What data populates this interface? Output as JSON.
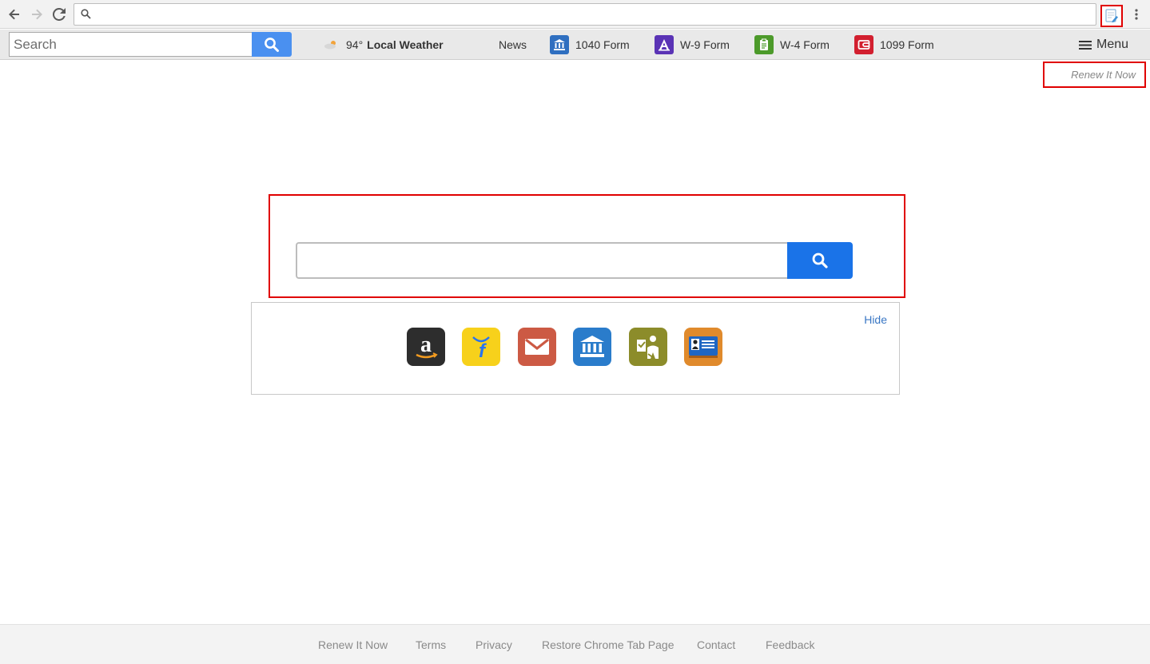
{
  "browser": {
    "address_value": "",
    "icons": [
      "back-arrow-icon",
      "forward-arrow-icon",
      "reload-icon",
      "search-icon",
      "extension-icon",
      "more-vert-icon"
    ]
  },
  "toolbar": {
    "search_placeholder": "Search",
    "weather": {
      "temp": "94°",
      "label": "Local Weather"
    },
    "news_label": "News",
    "links": [
      {
        "label": "1040 Form",
        "color": "#2f6fc0"
      },
      {
        "label": "W-9 Form",
        "color": "#5a33b5"
      },
      {
        "label": "W-4 Form",
        "color": "#4c9a2a"
      },
      {
        "label": "1099 Form",
        "color": "#d21f2f"
      }
    ],
    "menu_label": "Menu"
  },
  "renew_label": "Renew It Now",
  "main_search": {
    "value": ""
  },
  "shortcuts": {
    "hide_label": "Hide",
    "tiles": [
      {
        "name": "amazon",
        "color": "#2d2d2d"
      },
      {
        "name": "flipkart",
        "color": "#f7d11b"
      },
      {
        "name": "mail",
        "color": "#cc5a44"
      },
      {
        "name": "bank",
        "color": "#2a7ccb"
      },
      {
        "name": "immigration",
        "color": "#8c8c2a"
      },
      {
        "name": "id-card",
        "color": "#e08a2c"
      }
    ]
  },
  "footer": {
    "links": [
      "Renew It Now",
      "Terms",
      "Privacy",
      "Restore Chrome Tab Page",
      "Contact",
      "Feedback"
    ]
  }
}
